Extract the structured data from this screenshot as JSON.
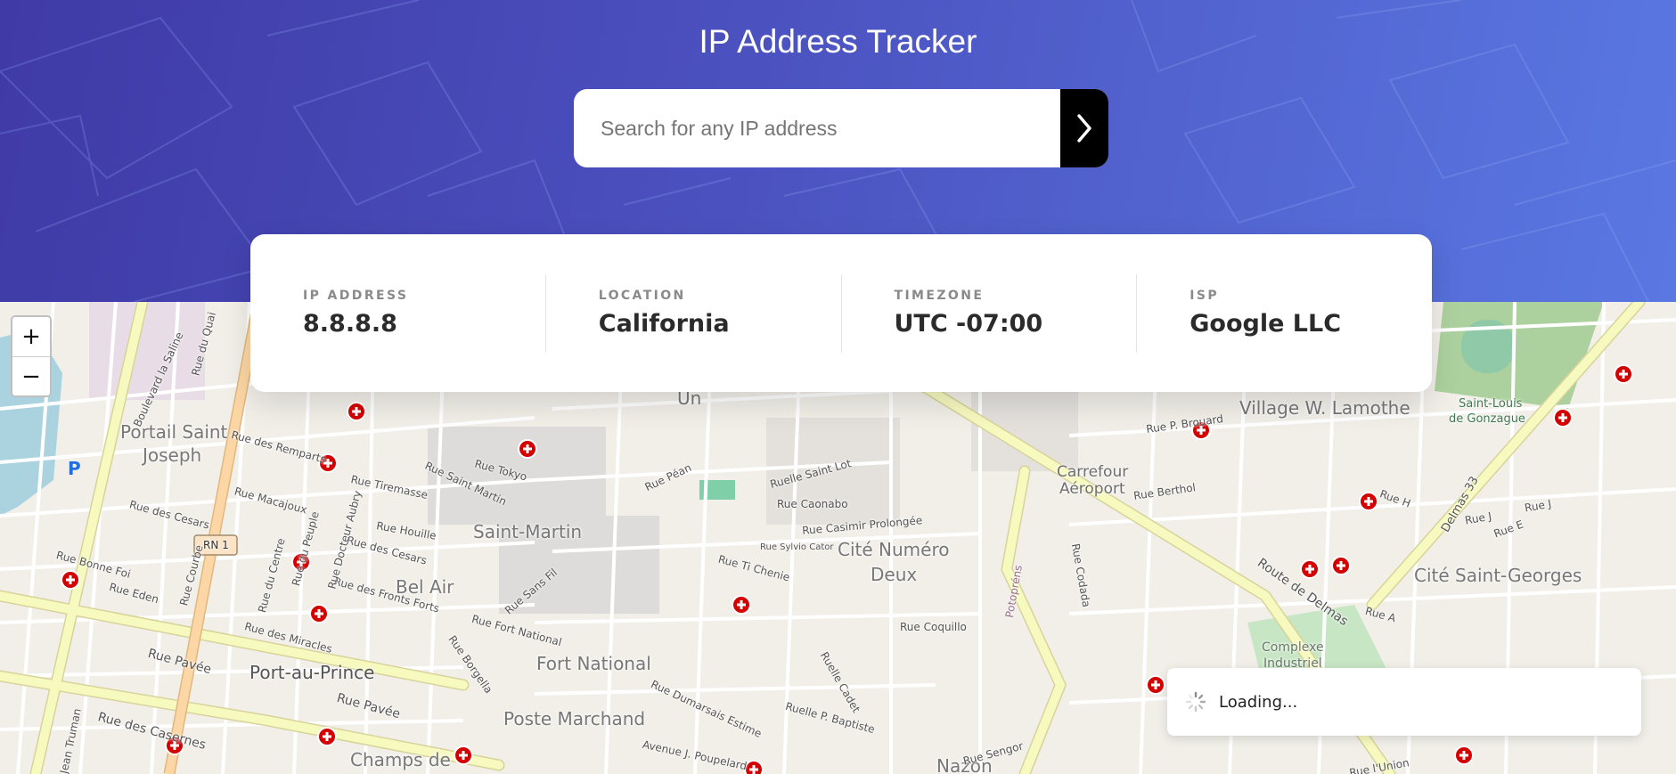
{
  "header": {
    "title": "IP Address Tracker"
  },
  "search": {
    "placeholder": "Search for any IP address",
    "value": "",
    "submit_icon": "chevron-right-icon"
  },
  "info": {
    "ip": {
      "label": "IP ADDRESS",
      "value": "8.8.8.8"
    },
    "location": {
      "label": "LOCATION",
      "value": "California"
    },
    "timezone": {
      "label": "TIMEZONE",
      "value": "UTC -07:00"
    },
    "isp": {
      "label": "ISP",
      "value": "Google LLC"
    }
  },
  "map": {
    "zoom_in_label": "+",
    "zoom_out_label": "−",
    "parking_label": "P",
    "route_shield": "RN 1",
    "places": {
      "portail": "Portail Saint",
      "joseph": "Joseph",
      "bel_air": "Bel Air",
      "saint_martin": "Saint-Martin",
      "port_au_prince": "Port-au-Prince",
      "fort_national": "Fort National",
      "poste_marchand": "Poste Marchand",
      "champs_de": "Champs de",
      "cite_numero": "Cité Numéro",
      "deux": "Deux",
      "village": "Village W. Lamothe",
      "cite_saint_georges": "Cité Saint-Georges",
      "nazon": "Nazon",
      "carrefour": "Carrefour",
      "aeroport": "Aéroport",
      "saint_louis": "Saint-Louis",
      "gonzague": "de Gonzague",
      "complexe": "Complexe",
      "industriel": "Industriel",
      "un": "Un"
    },
    "streets": {
      "boulevard": "Boulevard la Saline",
      "rue_du_quai": "Rue du Quai",
      "rue_des_remparts": "Rue des Remparts",
      "rue_macajoux": "Rue Macajoux",
      "rue_tiremasse": "Rue Tiremasse",
      "rue_saint_martin": "Rue Saint Martin",
      "rue_tokyo": "Rue Tokyo",
      "rue_pean": "Rue Péan",
      "ruelle_saint_lot": "Ruelle Saint Lot",
      "rue_caonabo": "Rue Caonabo",
      "rue_casimir": "Rue Casimir Prolongée",
      "rue_sylvio": "Rue Sylvio Cator",
      "rue_ti_chenie": "Rue Ti Chenie",
      "rue_des_cesars": "Rue des Cesars",
      "rue_houille": "Rue Houille",
      "rue_bonne_foi": "Rue Bonne Foi",
      "rue_eden": "Rue Eden",
      "rue_pavee": "Rue Pavée",
      "rue_des_casernes": "Rue des Casernes",
      "rue_des_fronts_forts": "Rue des Fronts Forts",
      "rue_des_miracles": "Rue des Miracles",
      "rue_fort_national": "Rue Fort National",
      "rue_borgella": "Rue Borgella",
      "rue_coquillo": "Rue Coquillo",
      "ruelle_cadet": "Ruelle Cadet",
      "rue_dumarsais": "Rue Dumarsais Estime",
      "ruelle_baptiste": "Ruelle P. Baptiste",
      "avenue_poupelard": "Avenue J. Poupelard",
      "route_de_delmas": "Route de Delmas",
      "rue_p_brouard": "Rue P. Brouard",
      "rue_berthol": "Rue Berthol",
      "rue_codada": "Rue Codada",
      "rue_sengor": "Rue Sengor",
      "rue_l_union": "Rue l'Union",
      "delmas_33": "Delmas 33",
      "rue_h": "Rue H",
      "rue_j": "Rue J",
      "rue_a": "Rue A",
      "rue_e": "Rue E",
      "potopresns": "Potopréns",
      "rue_docteur_aubry": "Rue Docteur Aubry",
      "rue_du_centre": "Rue du Centre",
      "rue_du_peuple": "Rue du Peuple",
      "rue_courbe": "Rue Courbe",
      "rue_sans_fil": "Rue Sans Fil",
      "jean_truman": "Jean Truman"
    },
    "colors": {
      "background": "#f2efe9",
      "major_road": "#f7fabf",
      "primary_road": "#fcd6a4",
      "park": "#add19e",
      "water": "#aad3df",
      "marker": "#d40000"
    }
  },
  "status": {
    "loading_text": "Loading..."
  }
}
